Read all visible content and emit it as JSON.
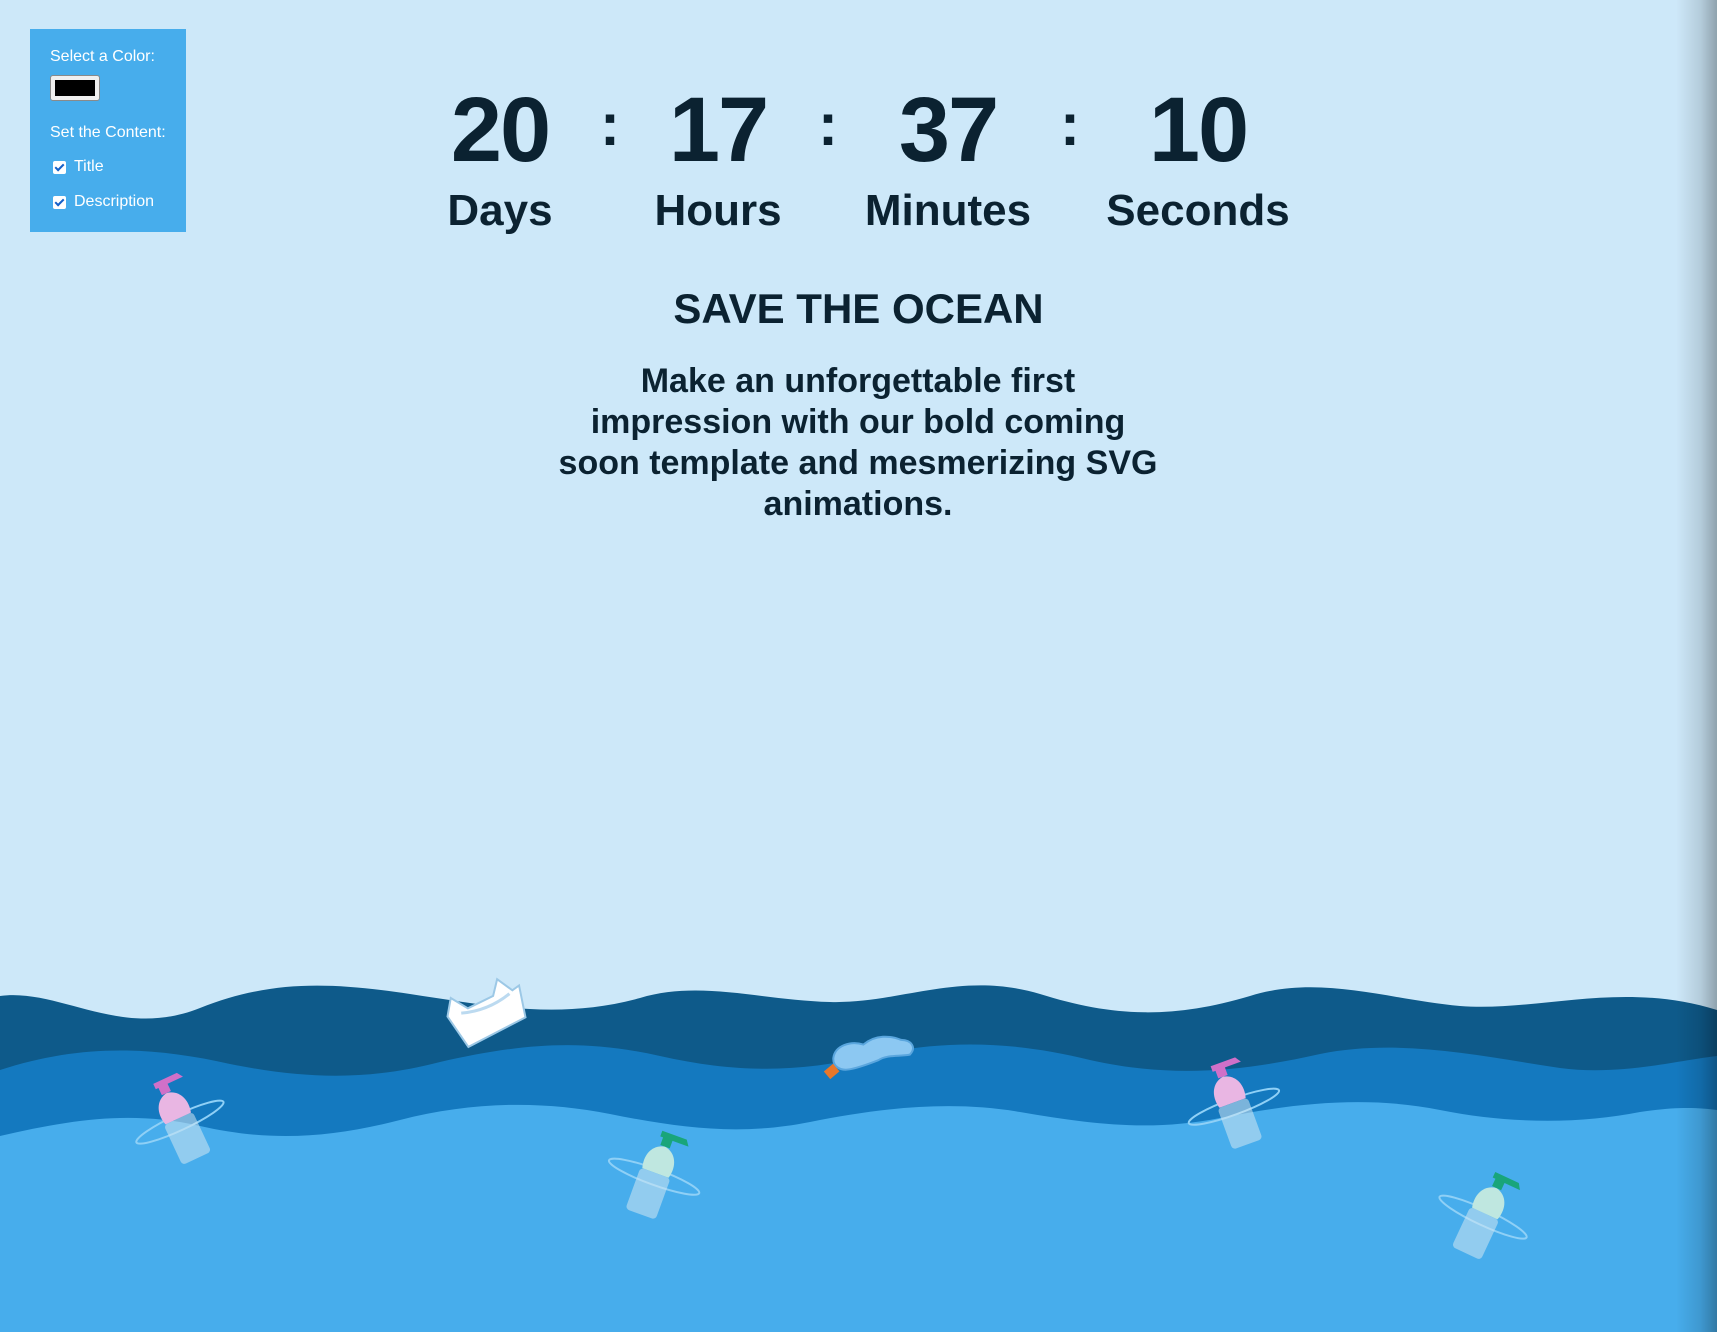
{
  "controls": {
    "color_label": "Select a Color:",
    "color_value": "#000000",
    "content_label": "Set the Content:",
    "options": [
      {
        "label": "Title",
        "checked": true
      },
      {
        "label": "Description",
        "checked": true
      }
    ]
  },
  "countdown": {
    "days": {
      "value": "20",
      "label": "Days"
    },
    "hours": {
      "value": "17",
      "label": "Hours"
    },
    "minutes": {
      "value": "37",
      "label": "Minutes"
    },
    "seconds": {
      "value": "10",
      "label": "Seconds"
    },
    "separator": ":"
  },
  "title": "SAVE THE OCEAN",
  "description": "Make an unforgettable first impression with our bold coming soon template and mesmerizing SVG animations.",
  "colors": {
    "background": "#cde8f9",
    "text": "#0b2231",
    "panel": "#47adec",
    "wave_deep": "#0e5a8a",
    "wave_mid": "#1479bf",
    "wave_light": "#47adec"
  },
  "illustration": {
    "items": [
      "plastic-bag-icon",
      "crumpled-bottle-icon",
      "spray-bottle-icon"
    ]
  }
}
